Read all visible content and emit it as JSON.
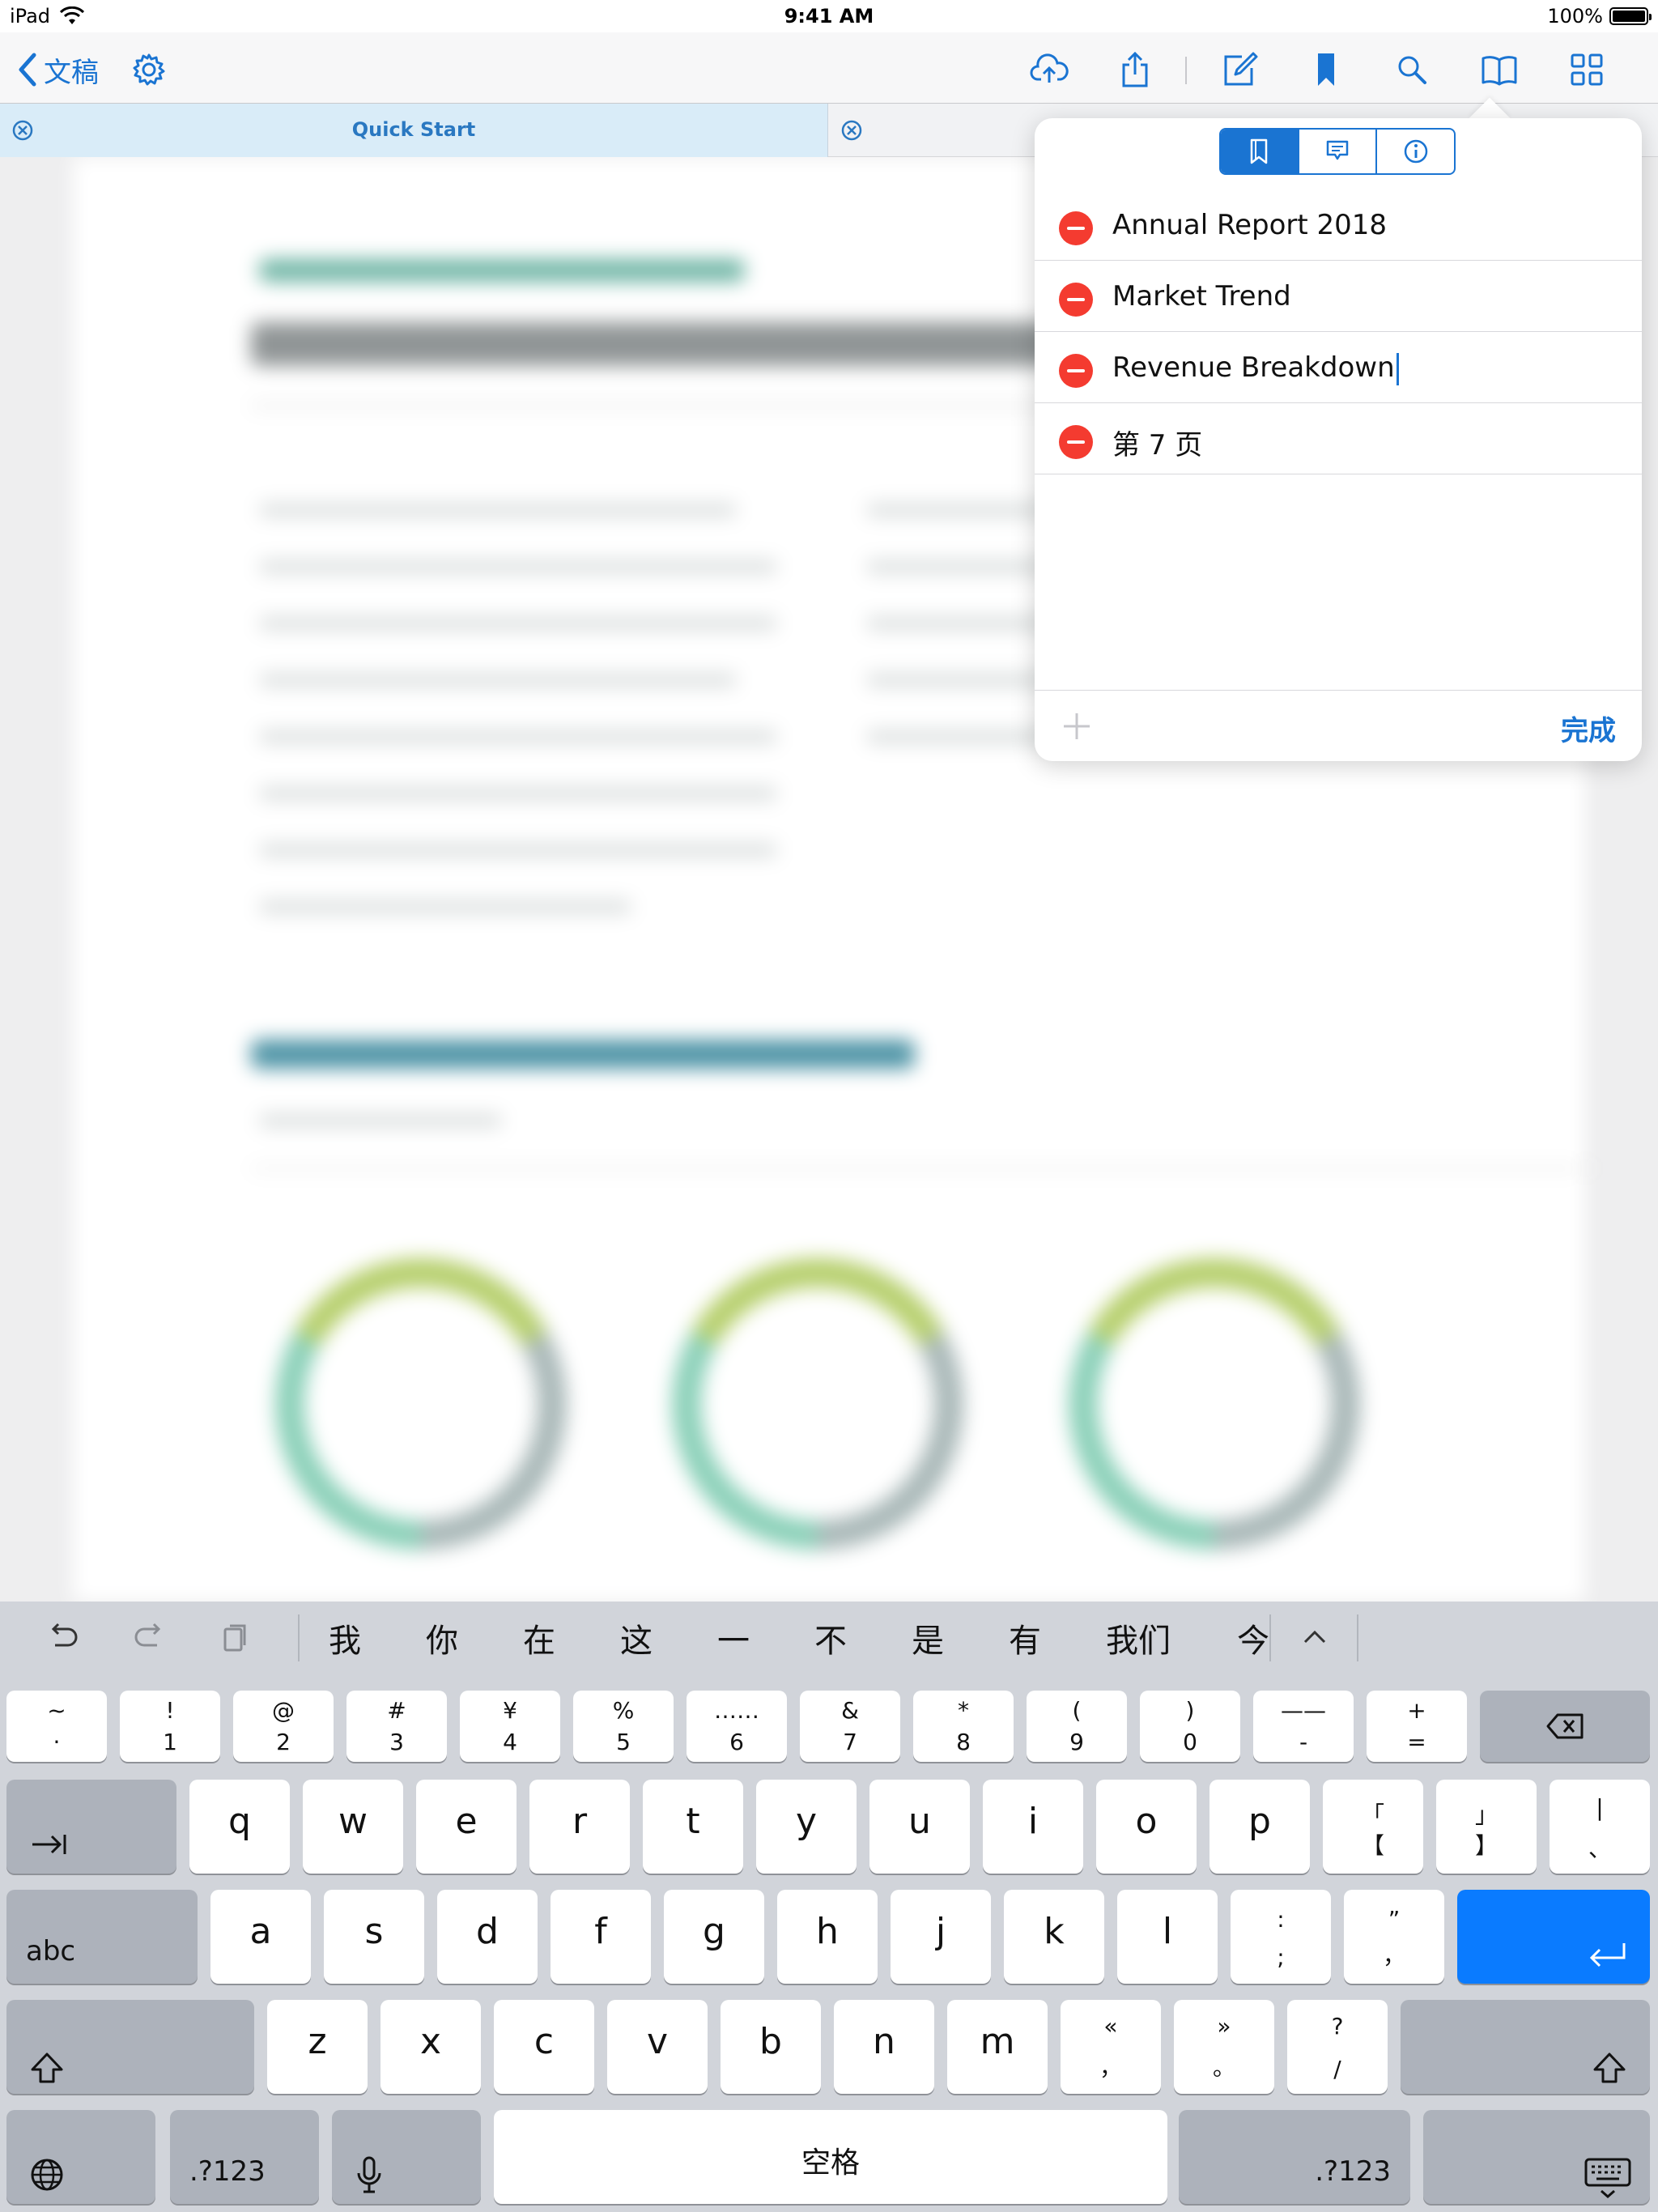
{
  "status": {
    "device": "iPad",
    "time": "9:41 AM",
    "battery": "100%",
    "battery_level": 1.0
  },
  "toolbar": {
    "back_label": "文稿",
    "icons": [
      "settings-gear-icon",
      "cloud-upload-icon",
      "share-icon",
      "edit-pencil-icon",
      "bookmark-icon",
      "search-icon",
      "book-icon",
      "grid-icon"
    ]
  },
  "tabs": {
    "active_title": "Quick Start"
  },
  "popover": {
    "segments": [
      "bookmark-icon",
      "comment-icon",
      "info-icon"
    ],
    "items": [
      {
        "label": "Annual Report 2018"
      },
      {
        "label": "Market Trend"
      },
      {
        "label": "Revenue Breakdown"
      },
      {
        "label": "第 7 页"
      }
    ],
    "done_label": "完成"
  },
  "keyboard": {
    "candidates": [
      "我",
      "你",
      "在",
      "这",
      "一",
      "不",
      "是",
      "有",
      "我们",
      "今"
    ],
    "row1": [
      {
        "top": "~",
        "bot": "·"
      },
      {
        "top": "!",
        "bot": "1"
      },
      {
        "top": "@",
        "bot": "2"
      },
      {
        "top": "#",
        "bot": "3"
      },
      {
        "top": "¥",
        "bot": "4"
      },
      {
        "top": "%",
        "bot": "5"
      },
      {
        "top": "……",
        "bot": "6"
      },
      {
        "top": "&",
        "bot": "7"
      },
      {
        "top": "*",
        "bot": "8"
      },
      {
        "top": "(",
        "bot": "9"
      },
      {
        "top": ")",
        "bot": "0"
      },
      {
        "top": "——",
        "bot": "-"
      },
      {
        "top": "+",
        "bot": "="
      }
    ],
    "row2": [
      "q",
      "w",
      "e",
      "r",
      "t",
      "y",
      "u",
      "i",
      "o",
      "p"
    ],
    "row2_extra": [
      {
        "top": "「",
        "bot": "【"
      },
      {
        "top": "」",
        "bot": "】"
      },
      {
        "top": "|",
        "bot": "、"
      }
    ],
    "row3": [
      "a",
      "s",
      "d",
      "f",
      "g",
      "h",
      "j",
      "k",
      "l"
    ],
    "row3_extra": [
      {
        "top": ":",
        "bot": ";"
      },
      {
        "top": "”",
        "bot": "，"
      }
    ],
    "row4": [
      "z",
      "x",
      "c",
      "v",
      "b",
      "n",
      "m"
    ],
    "row4_extra": [
      {
        "top": "«",
        "bot": "，"
      },
      {
        "top": "»",
        "bot": "。"
      },
      {
        "top": "?",
        "bot": "/"
      }
    ],
    "abc_label": "abc",
    "numbers_label": ".?123",
    "space_label": "空格"
  }
}
